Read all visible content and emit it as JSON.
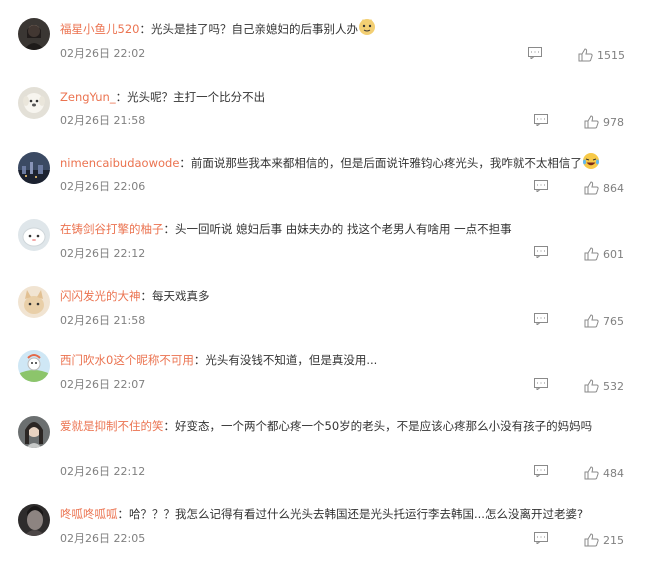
{
  "comments": [
    {
      "avatar": "avatar-girl-dark",
      "username": "福星小鱼儿520",
      "separator": "：",
      "text": "光头是挂了吗？自己亲媳妇的后事别人办",
      "emoji": "doge-emoji",
      "time": "02月26日 22:02",
      "likes": "1515"
    },
    {
      "avatar": "avatar-white-dog",
      "username": "ZengYun_",
      "separator": "：",
      "text": "光头呢？主打一个比分不出",
      "time": "02月26日 21:58",
      "likes": "978"
    },
    {
      "avatar": "avatar-night-city",
      "username": "nimencaibudaowode",
      "separator": "：",
      "text": "前面说那些我本来都相信的，但是后面说许雅钧心疼光头，我咋就不太相信了",
      "emoji": "laughing-tears-emoji",
      "time": "02月26日 22:06",
      "likes": "864"
    },
    {
      "avatar": "avatar-white-sheep",
      "username": "在铸剑谷打擎的柚子",
      "separator": "：",
      "text": "头一回听说 媳妇后事 由妹夫办的 找这个老男人有啥用 一点不担事",
      "time": "02月26日 22:12",
      "likes": "601"
    },
    {
      "avatar": "avatar-cat",
      "username": "闪闪发光的大神",
      "separator": "：",
      "text": "每天戏真多",
      "time": "02月26日 21:58",
      "likes": "765"
    },
    {
      "avatar": "avatar-cartoon",
      "username": "西门吹水0这个昵称不可用",
      "separator": "：",
      "text": "光头有没钱不知道，但是真没用...",
      "time": "02月26日 22:07",
      "likes": "532"
    },
    {
      "avatar": "avatar-girl-face",
      "username": "爱就是抑制不住的笑",
      "separator": "：",
      "text": "好变态，一个两个都心疼一个50岁的老头，不是应该心疼那么小没有孩子的妈妈吗",
      "time": "02月26日 22:12",
      "likes": "484"
    },
    {
      "avatar": "avatar-dark-portrait",
      "username": "咚呱咚呱呱",
      "separator": "：",
      "text": "哈？？？我怎么记得有看过什么光头去韩国还是光头托运行李去韩国...怎么没离开过老婆?",
      "time": "02月26日 22:05",
      "likes": "215"
    }
  ],
  "icons": {
    "reply": "comment-icon",
    "like": "thumbs-up-icon"
  },
  "colors": {
    "username": "#eb7350",
    "meta": "#808080",
    "text": "#333333"
  }
}
